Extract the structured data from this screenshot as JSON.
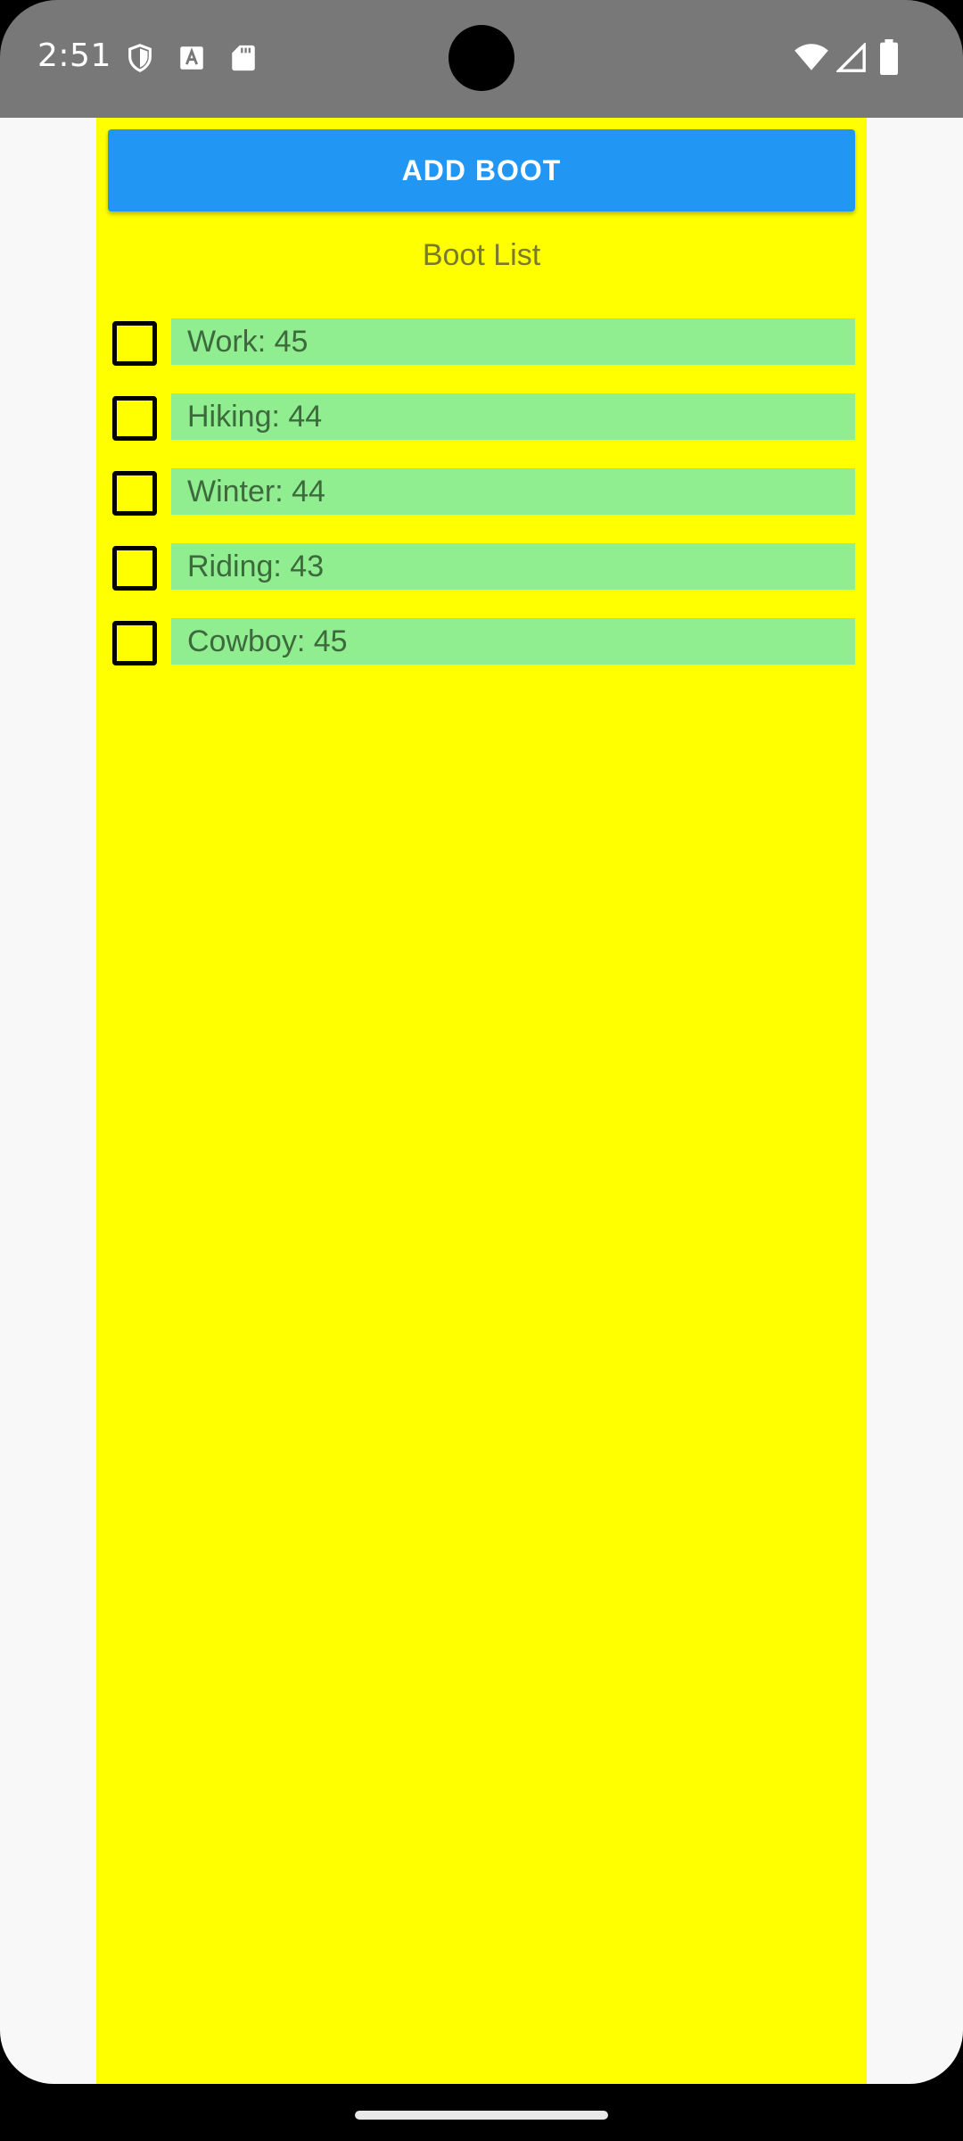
{
  "status_bar": {
    "time": "2:51",
    "left_icons": [
      "shield-icon",
      "text-a-icon",
      "sd-card-icon"
    ],
    "right_icons": [
      "wifi-icon",
      "cell-signal-icon",
      "battery-icon"
    ]
  },
  "colors": {
    "status_bar": "#787878",
    "panel": "#ffff00",
    "button": "#2196f3",
    "row": "#90ee90"
  },
  "toolbar": {
    "add_label": "ADD BOOT"
  },
  "list": {
    "title": "Boot List",
    "items": [
      {
        "label": "Work: 45",
        "checked": false
      },
      {
        "label": "Hiking: 44",
        "checked": false
      },
      {
        "label": "Winter: 44",
        "checked": false
      },
      {
        "label": "Riding: 43",
        "checked": false
      },
      {
        "label": "Cowboy: 45",
        "checked": false
      }
    ]
  }
}
